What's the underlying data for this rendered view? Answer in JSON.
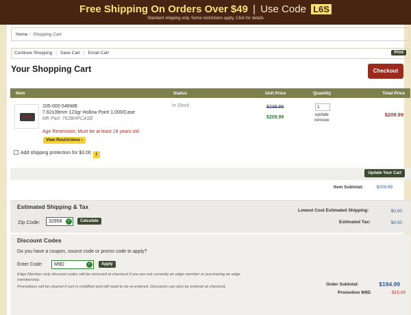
{
  "promo_banner": {
    "headline": "Free Shipping On Orders Over $49",
    "separator": "|",
    "code_prefix": "Use Code",
    "code": "L6S",
    "subtext": "Standard shipping only. Some restrictions apply. Click for details"
  },
  "breadcrumb": {
    "home": "Home",
    "current": "Shopping Cart"
  },
  "cart_actions": {
    "continue": "Continue Shopping",
    "save": "Save Cart",
    "email": "Email Cart",
    "print": "Print"
  },
  "page_title": "Your Shopping Cart",
  "checkout_label": "Checkout",
  "table_headers": {
    "item": "Item",
    "status": "Status",
    "unit_price": "Unit Price",
    "quantity": "Quantity",
    "total_price": "Total Price"
  },
  "item": {
    "sku": "105-000-546WB",
    "name": "7.62x39mm 123gr Hollow Point 1,000/Case",
    "mfr_part": "Mfr Part: 762BHPCASE",
    "age_restriction": "Age Restriction: Must be at least 18 years old",
    "view_restrictions": "View Restrictions ›",
    "status": "In Stock",
    "list_price": "$239.99",
    "sale_price": "$209.99",
    "quantity": "1",
    "update_label": "update",
    "remove_label": "remove",
    "total": "$209.99"
  },
  "shipping_protection": {
    "label": "Add shipping protection for $3.00",
    "info": "i"
  },
  "update_cart_label": "Update Your Cart",
  "item_subtotal": {
    "label": "Item Subtotal:",
    "value": "$209.99"
  },
  "shipping_tax": {
    "title": "Estimated Shipping & Tax",
    "zip_label": "Zip Code:",
    "zip_value": "32958",
    "calculate_label": "Calculate",
    "lowest_shipping_label": "Lowest Cost Estimated Shipping:",
    "lowest_shipping_value": "$0.00",
    "tax_label": "Estimated Tax:",
    "tax_value": "$0.00"
  },
  "discount": {
    "title": "Discount Codes",
    "question": "Do you have a coupon, source code or promo code to apply?",
    "code_label": "Enter Code:",
    "code_value": "M9D",
    "apply_label": "Apply",
    "note1": "Edge Member only discount codes will be removed at checkout if you are not currently an edge member or purchasing an edge membership.",
    "note2": "Promotions will be cleared if cart is modified and will need to be re-entered. Discounts can also be entered at checkout.",
    "promo_label": "Promotion M9D",
    "promo_value": "- $15.00"
  },
  "order_subtotal": {
    "label": "Order Subtotal:",
    "value": "$194.99"
  },
  "colors": {
    "banner_bg": "#4a2412",
    "banner_text": "#f7e27a",
    "table_header": "#7d7f4c",
    "checkout_button": "#9b2b1e",
    "dark_button": "#3d4a31",
    "price_red": "#b7261e",
    "price_green": "#2e7d32",
    "link_blue": "#2f5b8c"
  }
}
